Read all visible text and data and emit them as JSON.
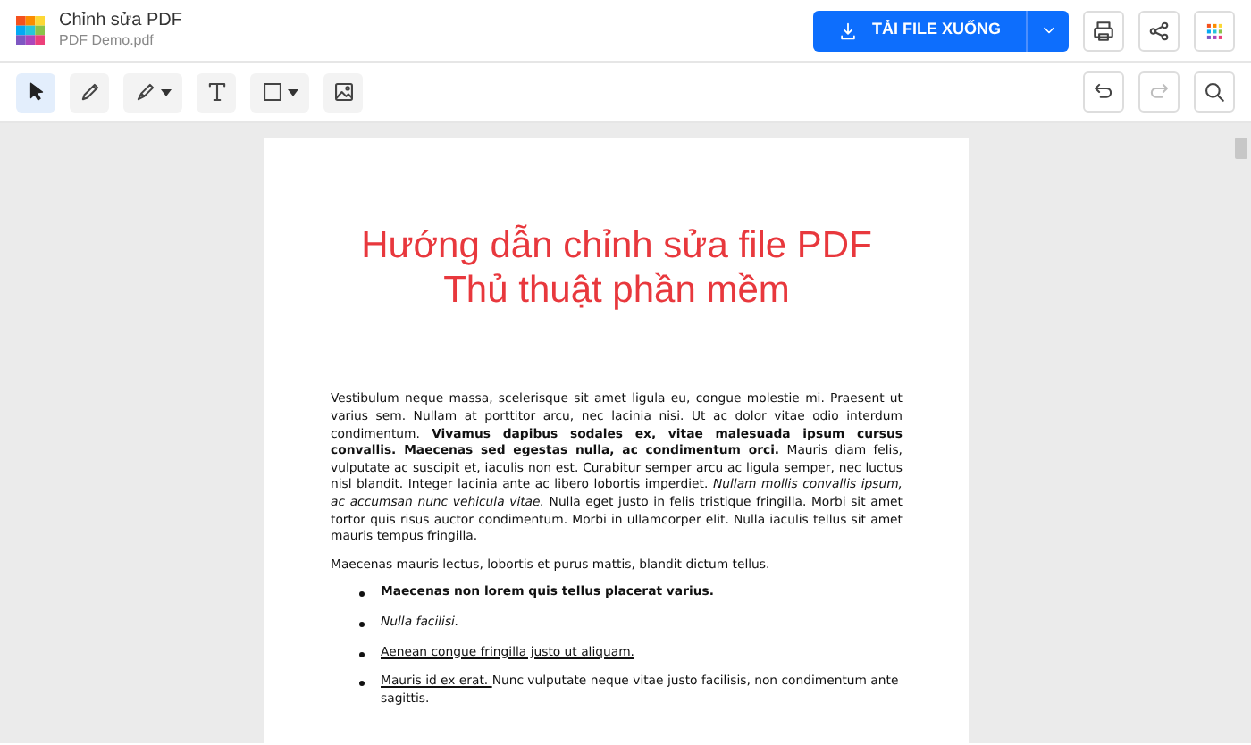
{
  "app": {
    "title": "Chỉnh sửa PDF",
    "filename": "PDF Demo.pdf"
  },
  "download": {
    "label": "TẢI FILE XUỐNG"
  },
  "header_actions": [
    {
      "kind": "print"
    },
    {
      "kind": "share"
    },
    {
      "kind": "apps"
    }
  ],
  "tools": [
    {
      "kind": "select",
      "selected": true,
      "dropdown": false
    },
    {
      "kind": "pencil",
      "selected": false,
      "dropdown": false
    },
    {
      "kind": "highlighter",
      "selected": false,
      "dropdown": true
    },
    {
      "kind": "text",
      "selected": false,
      "dropdown": false
    },
    {
      "kind": "rectangle",
      "selected": false,
      "dropdown": true
    },
    {
      "kind": "image",
      "selected": false,
      "dropdown": false
    }
  ],
  "history": [
    {
      "kind": "undo",
      "disabled": false
    },
    {
      "kind": "redo",
      "disabled": true
    },
    {
      "kind": "search",
      "disabled": false
    }
  ],
  "document": {
    "title_lines": [
      "Hướng dẫn chỉnh sửa file PDF",
      "Thủ thuật phần mềm"
    ],
    "paragraphs": [
      "Vestibulum neque massa, scelerisque sit amet ligula eu, congue molestie mi. Praesent ut varius sem. Nullam at porttitor arcu, nec lacinia nisi. Ut ac dolor vitae odio interdum condimentum. **Vivamus dapibus sodales ex, vitae malesuada ipsum cursus convallis. Maecenas sed egestas nulla, ac condimentum orci.** Mauris diam felis, vulputate ac suscipit et, iaculis non est. Curabitur semper arcu ac ligula semper, nec luctus nisl blandit. Integer lacinia ante ac libero lobortis imperdiet. *Nullam mollis convallis ipsum, ac accumsan nunc vehicula vitae.* Nulla eget justo in felis tristique fringilla. Morbi sit amet tortor quis risus auctor condimentum. Morbi in ullamcorper elit. Nulla iaculis tellus sit amet mauris tempus fringilla.",
      "Maecenas mauris lectus, lobortis et purus mattis, blandit dictum tellus."
    ],
    "list_items": [
      {
        "kind": "bold",
        "text": "Maecenas non lorem quis tellus placerat varius."
      },
      {
        "kind": "italic",
        "text": "Nulla facilisi."
      },
      {
        "kind": "underline",
        "text": "Aenean congue fringilla justo ut aliquam. "
      },
      {
        "kind": "mixed",
        "underlined": "Mauris id ex erat. ",
        "text": "Nunc vulputate neque vitae justo facilisis, non condimentum ante sagittis."
      }
    ]
  }
}
